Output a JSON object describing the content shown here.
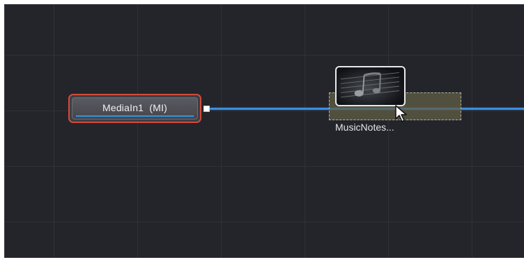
{
  "node_editor": {
    "background_color": "#24252a",
    "grid_color": "#303136",
    "connection_color": "#3b8fe0"
  },
  "nodes": {
    "mediain": {
      "label": "MediaIn1  (MI)",
      "border_color": "#d34a3a",
      "selected": true
    },
    "music_notes": {
      "label": "MusicNotes...",
      "thumbnail_icon": "music-notes-thumbnail"
    }
  },
  "cursor": {
    "icon": "arrow-cursor-icon"
  }
}
